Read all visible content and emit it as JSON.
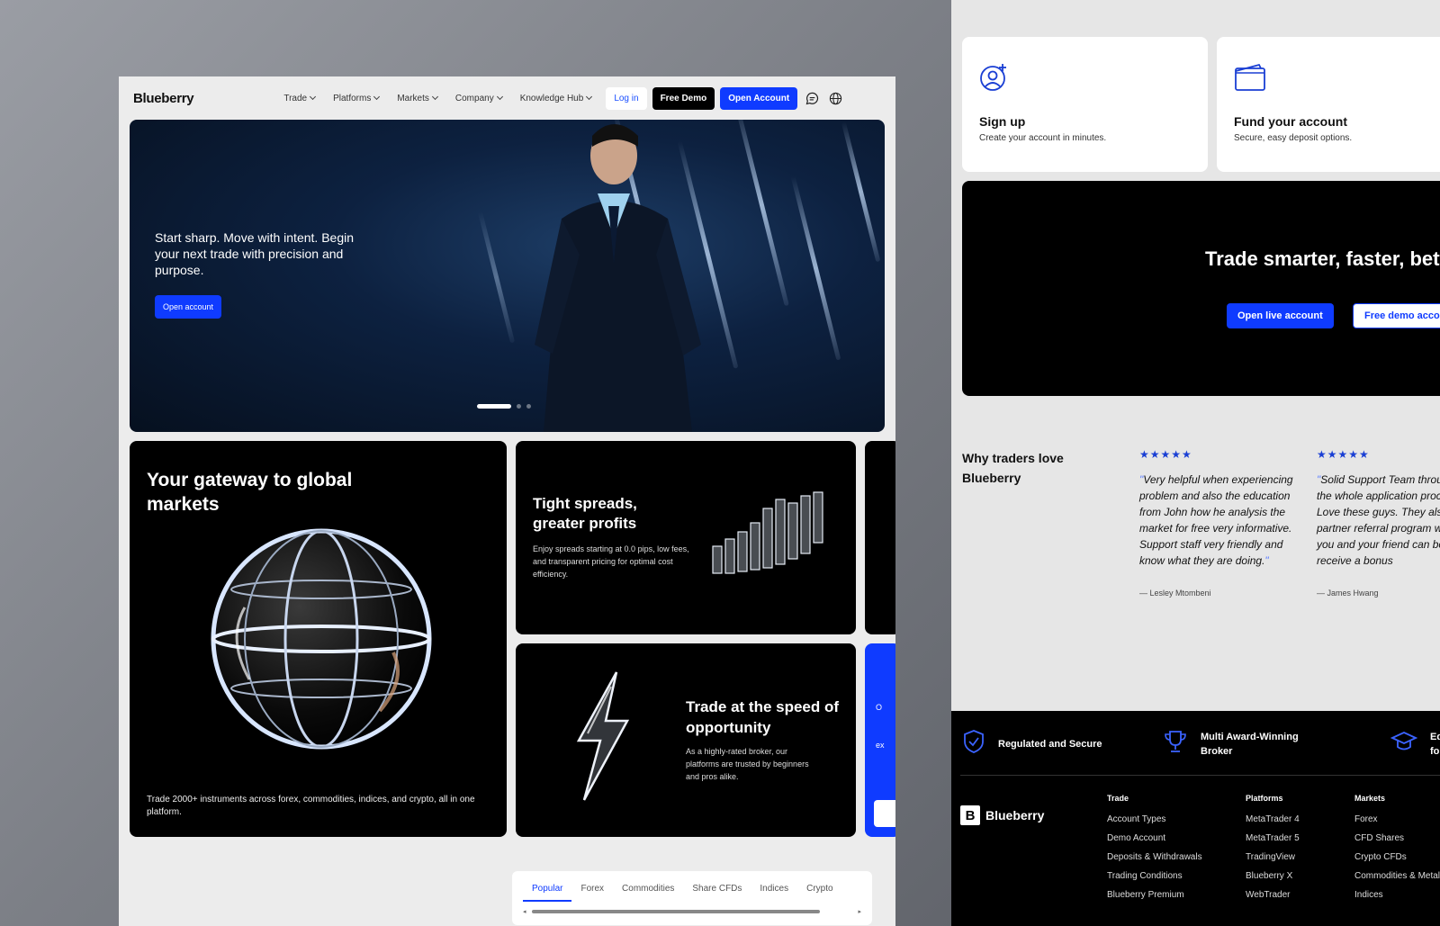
{
  "nav": {
    "logo": "Blueberry",
    "menu": [
      "Trade",
      "Platforms",
      "Markets",
      "Company",
      "Knowledge Hub"
    ],
    "login": "Log in",
    "free_demo": "Free Demo",
    "open_account": "Open Account",
    "icons": [
      "chat-icon",
      "globe-icon"
    ]
  },
  "hero": {
    "text": "Start sharp. Move with intent. Begin your next trade with precision and purpose.",
    "button": "Open account",
    "slides": 3,
    "active_slide": 1
  },
  "cards": {
    "gateway": {
      "title": "Your gateway to global markets",
      "desc": "Trade 2000+ instruments across forex, commodities, indices, and crypto, all in one platform."
    },
    "spreads": {
      "title": "Tight spreads, greater profits",
      "desc": "Enjoy spreads starting at 0.0 pips, low fees, and transparent pricing for optimal cost efficiency."
    },
    "speed": {
      "title": "Trade at the speed of opportunity",
      "desc": "As a highly-rated broker, our platforms are trusted by beginners and pros alike."
    },
    "peek_text_1": "O",
    "peek_text_2": "ex"
  },
  "market_tabs": {
    "items": [
      "Popular",
      "Forex",
      "Commodities",
      "Share CFDs",
      "Indices",
      "Crypto"
    ],
    "active": "Popular"
  },
  "steps": [
    {
      "title": "Sign up",
      "desc": "Create your account in minutes.",
      "icon": "user-add-icon"
    },
    {
      "title": "Fund your account",
      "desc": "Secure, easy deposit options.",
      "icon": "wallet-icon"
    }
  ],
  "cta": {
    "title": "Trade smarter, faster, better",
    "live_button": "Open live account",
    "demo_button": "Free demo account"
  },
  "reviews": {
    "heading": "Why traders love Blueberry",
    "stars": "★★★★★",
    "items": [
      {
        "quote": "Very helpful when experiencing problem and also the education from John how he analysis the market for free very informative. Support staff very friendly and know what they are doing.",
        "author": "— Lesley Mtombeni"
      },
      {
        "quote": "Solid Support Team throughout the whole application process! Love these guys. They also offer partner referral program where you and your friend can both receive a bonus",
        "author": "— James Hwang"
      }
    ]
  },
  "footer": {
    "badges": [
      "Regulated and Secure",
      "Multi Award-Winning Broker",
      "Education for"
    ],
    "logo": "Blueberry",
    "logo_mark": "B",
    "columns": [
      {
        "head": "Trade",
        "links": [
          "Account Types",
          "Demo Account",
          "Deposits & Withdrawals",
          "Trading Conditions",
          "Blueberry Premium"
        ]
      },
      {
        "head": "Platforms",
        "links": [
          "MetaTrader 4",
          "MetaTrader 5",
          "TradingView",
          "Blueberry X",
          "WebTrader"
        ]
      },
      {
        "head": "Markets",
        "links": [
          "Forex",
          "CFD Shares",
          "Crypto CFDs",
          "Commodities & Metals",
          "Indices"
        ]
      }
    ]
  },
  "colors": {
    "accent": "#0f3bff",
    "page_bg": "#ececec",
    "dark": "#000000",
    "star": "#1a3fd4"
  }
}
